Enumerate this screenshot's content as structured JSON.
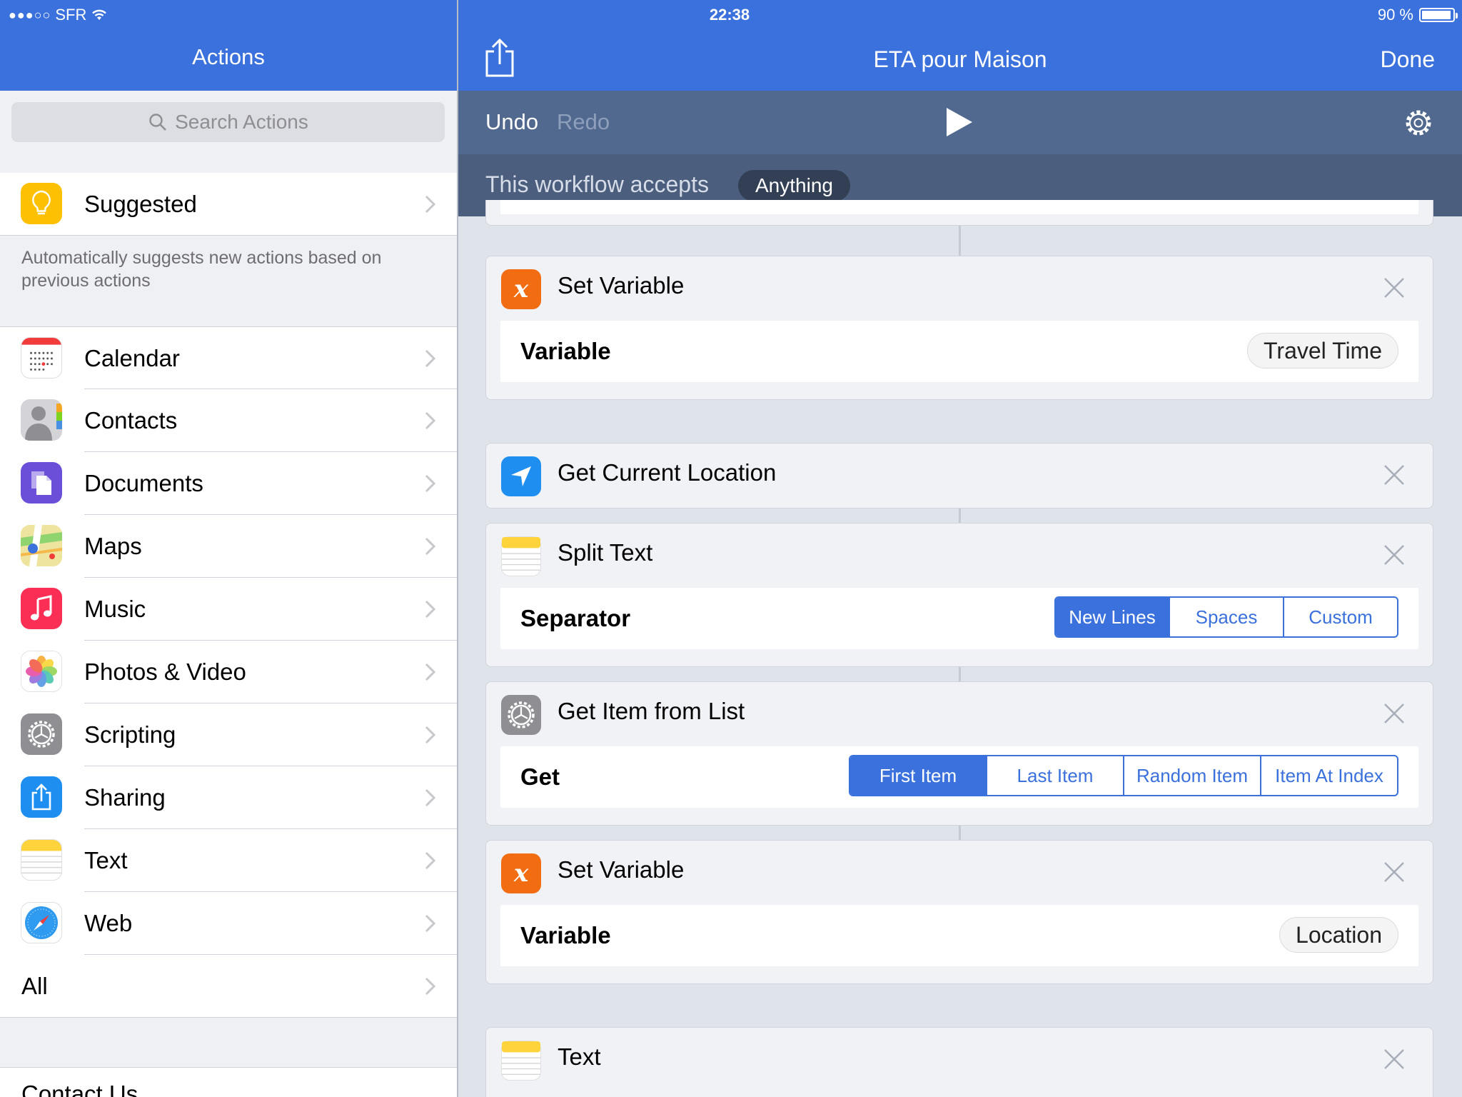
{
  "status": {
    "carrier": "SFR",
    "time": "22:38",
    "battery": "90 %"
  },
  "left": {
    "title": "Actions",
    "search_placeholder": "Search Actions",
    "suggested": {
      "label": "Suggested",
      "description": "Automatically suggests new actions based on previous actions"
    },
    "categories": [
      {
        "label": "Calendar",
        "icon": "calendar-icon"
      },
      {
        "label": "Contacts",
        "icon": "contacts-icon"
      },
      {
        "label": "Documents",
        "icon": "documents-icon"
      },
      {
        "label": "Maps",
        "icon": "maps-icon"
      },
      {
        "label": "Music",
        "icon": "music-icon"
      },
      {
        "label": "Photos & Video",
        "icon": "photos-icon"
      },
      {
        "label": "Scripting",
        "icon": "scripting-gear-icon"
      },
      {
        "label": "Sharing",
        "icon": "share-icon"
      },
      {
        "label": "Text",
        "icon": "notepad-icon"
      },
      {
        "label": "Web",
        "icon": "safari-compass-icon"
      }
    ],
    "all_label": "All",
    "contact_label": "Contact Us"
  },
  "header": {
    "title": "ETA pour Maison",
    "done_label": "Done"
  },
  "toolbar": {
    "undo_label": "Undo",
    "redo_label": "Redo"
  },
  "accepts": {
    "text": "This workflow accepts",
    "value": "Anything"
  },
  "actions": [
    {
      "title": "Set Variable",
      "param_label": "Variable",
      "param_value": "Travel Time"
    },
    {
      "title": "Get Current Location"
    },
    {
      "title": "Split Text",
      "param_label": "Separator",
      "options": [
        "New Lines",
        "Spaces",
        "Custom"
      ],
      "selected": "New Lines"
    },
    {
      "title": "Get Item from List",
      "param_label": "Get",
      "options": [
        "First Item",
        "Last Item",
        "Random Item",
        "Item At Index"
      ],
      "selected": "First Item"
    },
    {
      "title": "Set Variable",
      "param_label": "Variable",
      "param_value": "Location"
    },
    {
      "title": "Text"
    }
  ],
  "colors": {
    "accent": "#3a71dc",
    "toolbar": "#51698f",
    "accepts_bar": "#4c5e7e",
    "variable_orange": "#f26c12"
  }
}
